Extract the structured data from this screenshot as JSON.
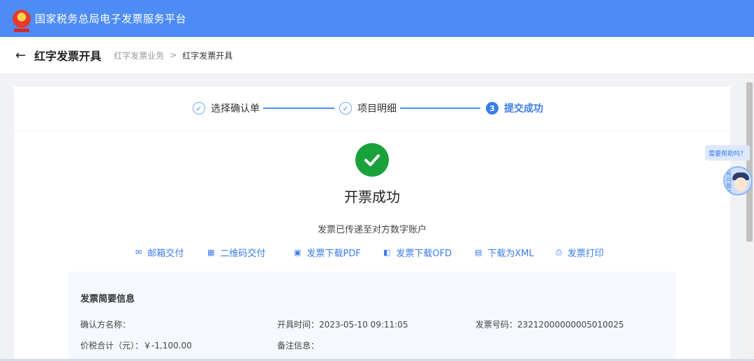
{
  "header": {
    "title": "国家税务总局电子发票服务平台"
  },
  "subheader": {
    "back_icon": "←",
    "title": "红字发票开具",
    "breadcrumb": [
      "红字发票业务",
      "红字发票开具"
    ],
    "separator": ">"
  },
  "steps": [
    {
      "icon": "✓",
      "label": "选择确认单"
    },
    {
      "icon": "✓",
      "label": "项目明细"
    },
    {
      "icon": "3",
      "label": "提交成功"
    }
  ],
  "result": {
    "title": "开票成功",
    "subtitle": "发票已传递至对方数字账户"
  },
  "actions": [
    {
      "icon": "✉",
      "label": "邮箱交付"
    },
    {
      "icon": "▦",
      "label": "二维码交付"
    },
    {
      "icon": "▣",
      "label": "发票下载PDF"
    },
    {
      "icon": "◧",
      "label": "发票下载OFD"
    },
    {
      "icon": "▤",
      "label": "下载为XML"
    },
    {
      "icon": "⎙",
      "label": "发票打印"
    }
  ],
  "summary": {
    "title": "发票简要信息",
    "buyer_name_label": "确认方名称：",
    "issue_time": "开具时间：2023-05-10 09:11:05",
    "invoice_number": "发票号码：23212000000005010025",
    "total_amount": "价税合计（元）：￥-1,100.00",
    "remark_label": "备注信息："
  },
  "help": {
    "text": "需要帮助吗？",
    "tag": "有问题咨询"
  },
  "colors": {
    "primary": "#4d8cf5",
    "success": "#19a13a",
    "link": "#3a7cf0"
  }
}
